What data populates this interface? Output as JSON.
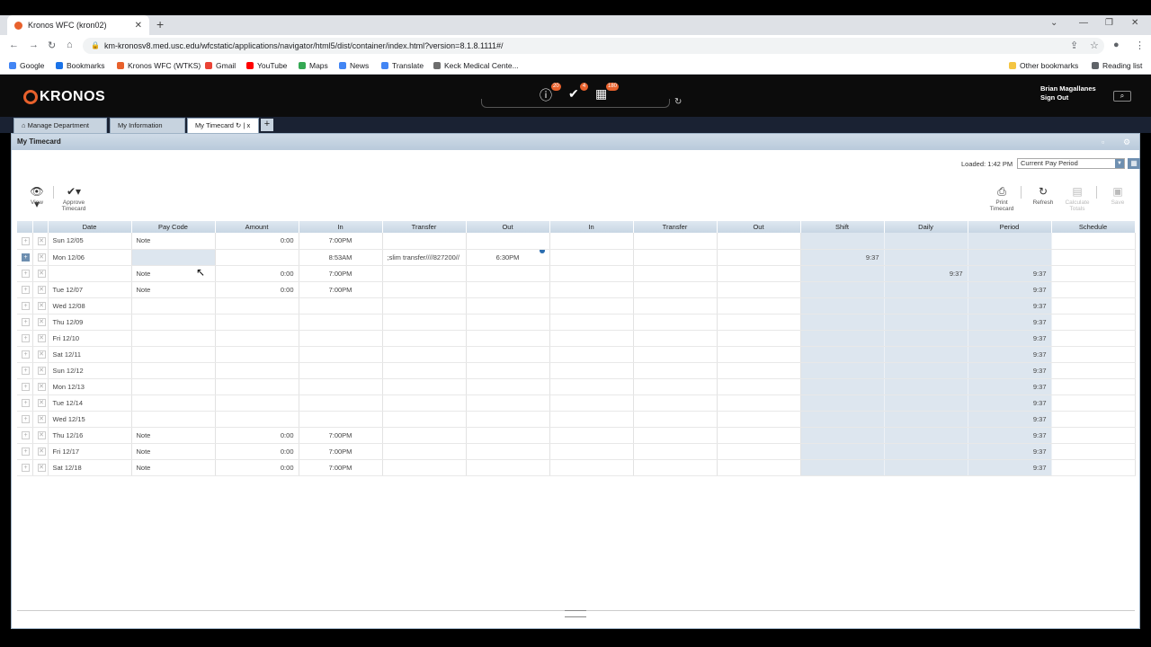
{
  "browser": {
    "tab_title": "Kronos WFC (kron02)",
    "url": "km-kronosv8.med.usc.edu/wfcstatic/applications/navigator/html5/dist/container/index.html?version=8.1.8.1111#/",
    "bookmarks": [
      "Google",
      "Bookmarks",
      "Kronos WFC (WTKS)",
      "Gmail",
      "YouTube",
      "Maps",
      "News",
      "Translate",
      "Keck Medical Cente..."
    ],
    "other_bookmarks": "Other bookmarks",
    "reading_list": "Reading list"
  },
  "header": {
    "logo": "KRONOS",
    "alerts_count": "20",
    "approvals_count": "4",
    "calendar_count": "180",
    "user_name": "Brian Magallanes",
    "sign_out": "Sign Out"
  },
  "workspace_tabs": [
    "Manage Department",
    "My Information",
    "My Timecard"
  ],
  "panel": {
    "title": "My Timecard",
    "loaded": "Loaded: 1:42 PM",
    "period": "Current Pay Period"
  },
  "toolbar": {
    "view": "View",
    "approve": "Approve Timecard",
    "print": "Print Timecard",
    "refresh": "Refresh",
    "calc": "Calculate Totals",
    "save": "Save"
  },
  "columns": [
    "Date",
    "Pay Code",
    "Amount",
    "In",
    "Transfer",
    "Out",
    "In",
    "Transfer",
    "Out",
    "Shift",
    "Daily",
    "Period",
    "Schedule"
  ],
  "rows": [
    {
      "date": "Sun 12/05",
      "paycode": "Note",
      "amount": "0:00",
      "in": "7:00PM",
      "transfer": "",
      "out": "",
      "shift": "",
      "daily": "",
      "period": ""
    },
    {
      "date": "Mon 12/06",
      "paycode": "",
      "amount": "",
      "in": "8:53AM",
      "transfer": ";slim transfer////827200//",
      "out": "6:30PM",
      "shift": "9:37",
      "daily": "",
      "period": ""
    },
    {
      "date": "",
      "paycode": "Note",
      "amount": "0:00",
      "in": "7:00PM",
      "transfer": "",
      "out": "",
      "shift": "",
      "daily": "9:37",
      "period": "9:37"
    },
    {
      "date": "Tue 12/07",
      "paycode": "Note",
      "amount": "0:00",
      "in": "7:00PM",
      "transfer": "",
      "out": "",
      "shift": "",
      "daily": "",
      "period": "9:37"
    },
    {
      "date": "Wed 12/08",
      "paycode": "",
      "amount": "",
      "in": "",
      "transfer": "",
      "out": "",
      "shift": "",
      "daily": "",
      "period": "9:37"
    },
    {
      "date": "Thu 12/09",
      "paycode": "",
      "amount": "",
      "in": "",
      "transfer": "",
      "out": "",
      "shift": "",
      "daily": "",
      "period": "9:37"
    },
    {
      "date": "Fri 12/10",
      "paycode": "",
      "amount": "",
      "in": "",
      "transfer": "",
      "out": "",
      "shift": "",
      "daily": "",
      "period": "9:37"
    },
    {
      "date": "Sat 12/11",
      "paycode": "",
      "amount": "",
      "in": "",
      "transfer": "",
      "out": "",
      "shift": "",
      "daily": "",
      "period": "9:37"
    },
    {
      "date": "Sun 12/12",
      "paycode": "",
      "amount": "",
      "in": "",
      "transfer": "",
      "out": "",
      "shift": "",
      "daily": "",
      "period": "9:37"
    },
    {
      "date": "Mon 12/13",
      "paycode": "",
      "amount": "",
      "in": "",
      "transfer": "",
      "out": "",
      "shift": "",
      "daily": "",
      "period": "9:37"
    },
    {
      "date": "Tue 12/14",
      "paycode": "",
      "amount": "",
      "in": "",
      "transfer": "",
      "out": "",
      "shift": "",
      "daily": "",
      "period": "9:37"
    },
    {
      "date": "Wed 12/15",
      "paycode": "",
      "amount": "",
      "in": "",
      "transfer": "",
      "out": "",
      "shift": "",
      "daily": "",
      "period": "9:37"
    },
    {
      "date": "Thu 12/16",
      "paycode": "Note",
      "amount": "0:00",
      "in": "7:00PM",
      "transfer": "",
      "out": "",
      "shift": "",
      "daily": "",
      "period": "9:37"
    },
    {
      "date": "Fri 12/17",
      "paycode": "Note",
      "amount": "0:00",
      "in": "7:00PM",
      "transfer": "",
      "out": "",
      "shift": "",
      "daily": "",
      "period": "9:37"
    },
    {
      "date": "Sat 12/18",
      "paycode": "Note",
      "amount": "0:00",
      "in": "7:00PM",
      "transfer": "",
      "out": "",
      "shift": "",
      "daily": "",
      "period": "9:37"
    }
  ]
}
